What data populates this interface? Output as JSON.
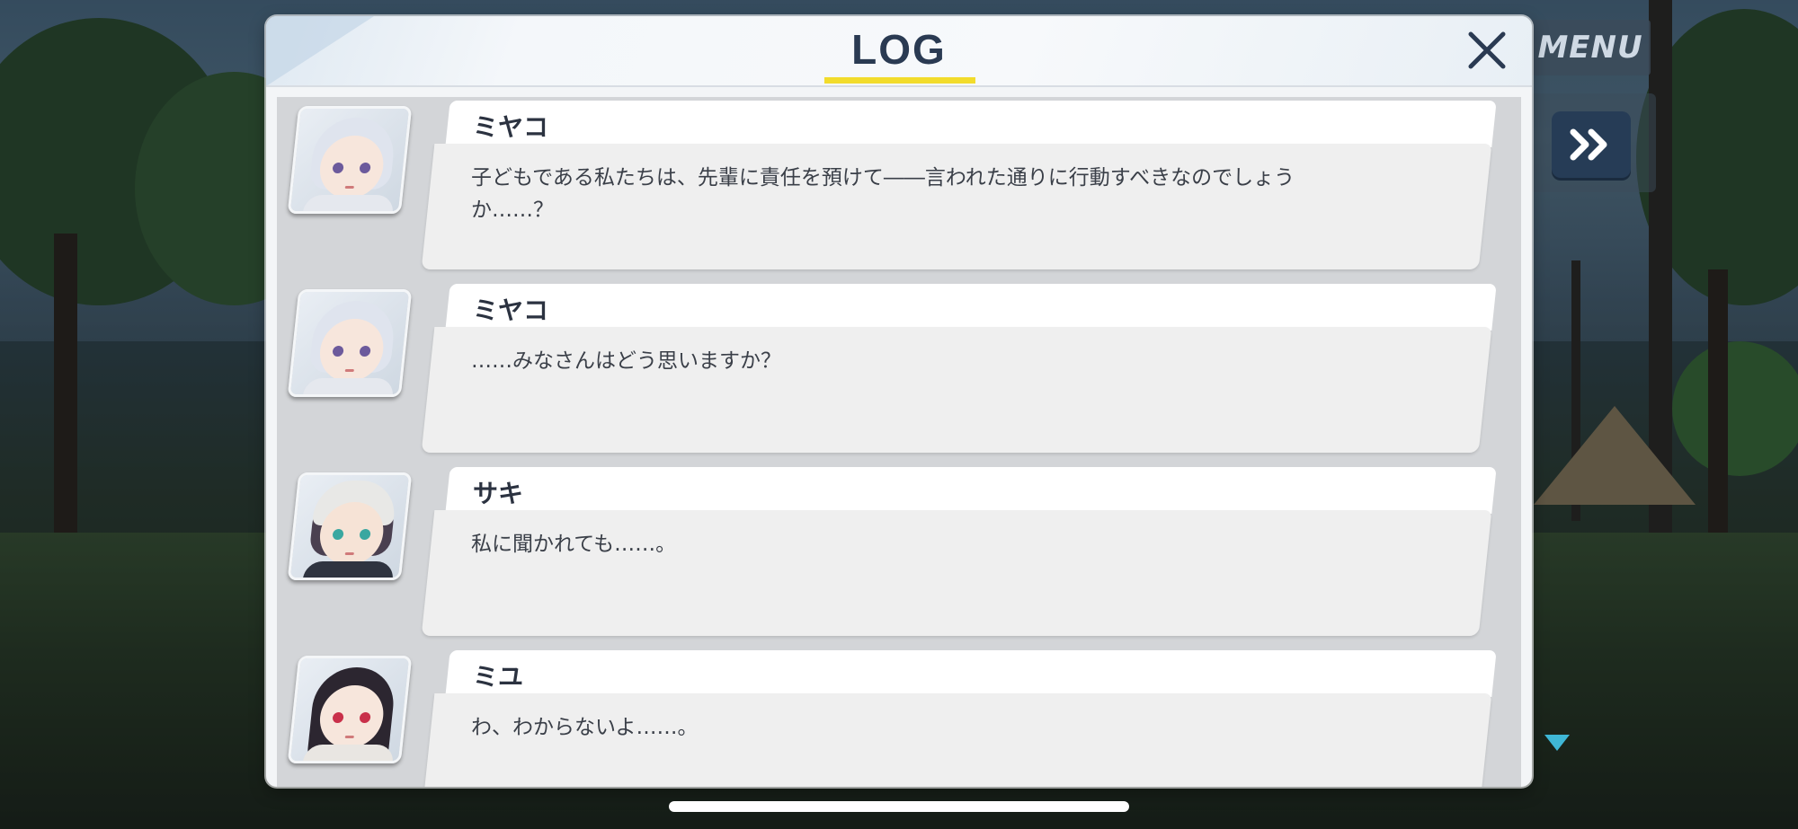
{
  "menu": {
    "label": "MENU"
  },
  "log": {
    "title": "LOG",
    "entries": [
      {
        "speaker": "ミヤコ",
        "text": "子どもである私たちは、先輩に責任を預けて――言われた通りに行動すべきなのでしょうか……？",
        "avatar": "miyako-portrait"
      },
      {
        "speaker": "ミヤコ",
        "text": "……みなさんはどう思いますか？",
        "avatar": "miyako-portrait"
      },
      {
        "speaker": "サキ",
        "text": "私に聞かれても……。",
        "avatar": "saki-portrait"
      },
      {
        "speaker": "ミユ",
        "text": "わ、わからないよ……。",
        "avatar": "miyu-portrait"
      }
    ]
  },
  "colors": {
    "title_underline": "#f2dc2c",
    "title_text": "#2a3a52",
    "ff_button": "#263c56",
    "scroll_arrow": "#3fb7d6"
  },
  "icons": {
    "close": "close-icon",
    "fast_forward": "fast-forward-icon",
    "scroll_down": "scroll-down-icon"
  }
}
